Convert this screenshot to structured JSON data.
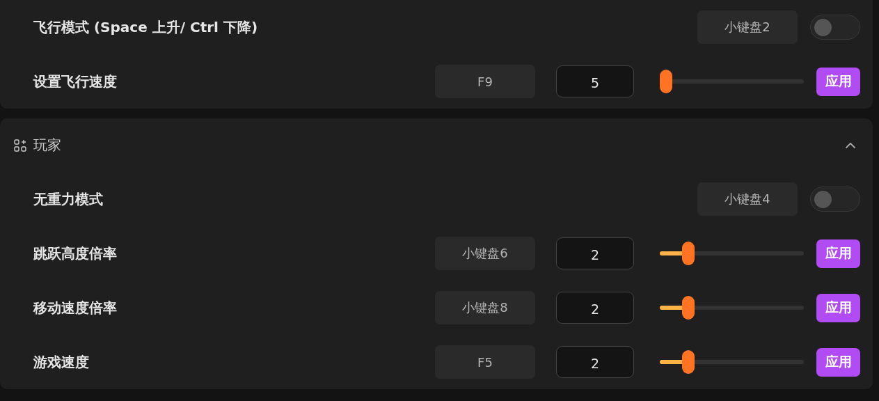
{
  "sections": [
    {
      "rows": [
        {
          "kind": "toggle",
          "label": "飞行模式 (Space 上升/ Ctrl 下降)",
          "hotkey": "小键盘2",
          "on": false
        },
        {
          "kind": "slider",
          "label": "设置飞行速度",
          "hotkey": "F9",
          "value": "5",
          "level": 0,
          "button": "应用"
        }
      ]
    },
    {
      "title": "玩家",
      "expanded": true,
      "rows": [
        {
          "kind": "toggle",
          "label": "无重力模式",
          "hotkey": "小键盘4",
          "on": false
        },
        {
          "kind": "slider",
          "label": "跳跃高度倍率",
          "hotkey": "小键盘6",
          "value": "2",
          "level": 0.17,
          "button": "应用"
        },
        {
          "kind": "slider",
          "label": "移动速度倍率",
          "hotkey": "小键盘8",
          "value": "2",
          "level": 0.17,
          "button": "应用"
        },
        {
          "kind": "slider",
          "label": "游戏速度",
          "hotkey": "F5",
          "value": "2",
          "level": 0.17,
          "button": "应用"
        }
      ]
    }
  ]
}
